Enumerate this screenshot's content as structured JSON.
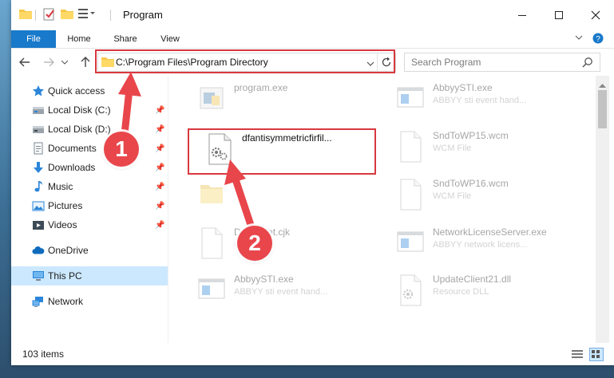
{
  "window": {
    "title": "Program"
  },
  "ribbon": {
    "tabs": [
      "File",
      "Home",
      "Share",
      "View"
    ]
  },
  "address": {
    "path": "C:\\Program Files\\Program Directory"
  },
  "search": {
    "placeholder": "Search Program"
  },
  "navigation": {
    "items": [
      {
        "label": "Quick access",
        "icon": "star-icon",
        "pinned": false
      },
      {
        "label": "Local Disk (C:)",
        "icon": "drive-icon",
        "pinned": true
      },
      {
        "label": "Local Disk (D:)",
        "icon": "drive-icon",
        "pinned": true
      },
      {
        "label": "Documents",
        "icon": "documents-icon",
        "pinned": true
      },
      {
        "label": "Downloads",
        "icon": "download-arrow-icon",
        "pinned": true
      },
      {
        "label": "Music",
        "icon": "music-note-icon",
        "pinned": true
      },
      {
        "label": "Pictures",
        "icon": "pictures-icon",
        "pinned": true
      },
      {
        "label": "Videos",
        "icon": "videos-icon",
        "pinned": true
      },
      {
        "label": "OneDrive",
        "icon": "cloud-icon",
        "pinned": false
      },
      {
        "label": "This PC",
        "icon": "computer-icon",
        "pinned": false,
        "selected": true
      },
      {
        "label": "Network",
        "icon": "network-icon",
        "pinned": false
      }
    ]
  },
  "files": [
    {
      "name": "program.exe",
      "sub": "",
      "icon": "exe-icon"
    },
    {
      "name": "AbbyySTI.exe",
      "sub": "ABBYY sti event hand...",
      "icon": "exe-window-icon"
    },
    {
      "name": "dfantisymmetricfirfil...",
      "sub": "",
      "icon": "gear-file-icon",
      "highlighted": true
    },
    {
      "name": "SndToWP15.wcm",
      "sub": "WCM File",
      "icon": "blank-file-icon"
    },
    {
      "name": "",
      "sub": "",
      "icon": "folder-icon"
    },
    {
      "name": "SndToWP16.wcm",
      "sub": "WCM File",
      "icon": "blank-file-icon"
    },
    {
      "name": "Defa...ent.cjk",
      "sub": "CJ...",
      "icon": "blank-file-icon"
    },
    {
      "name": "NetworkLicenseServer.exe",
      "sub": "ABBYY network licens...",
      "icon": "exe-window-icon"
    },
    {
      "name": "AbbyySTI.exe",
      "sub": "ABBYY sti event hand...",
      "icon": "exe-window-icon"
    },
    {
      "name": "UpdateClient21.dll",
      "sub": "Resource DLL",
      "icon": "dll-gear-icon"
    }
  ],
  "status": {
    "item_count": "103 items"
  },
  "annotations": {
    "step1": "1",
    "step2": "2"
  },
  "colors": {
    "accent": "#1979ca",
    "annotation_red": "#d8383f",
    "selection": "#cce8ff"
  }
}
